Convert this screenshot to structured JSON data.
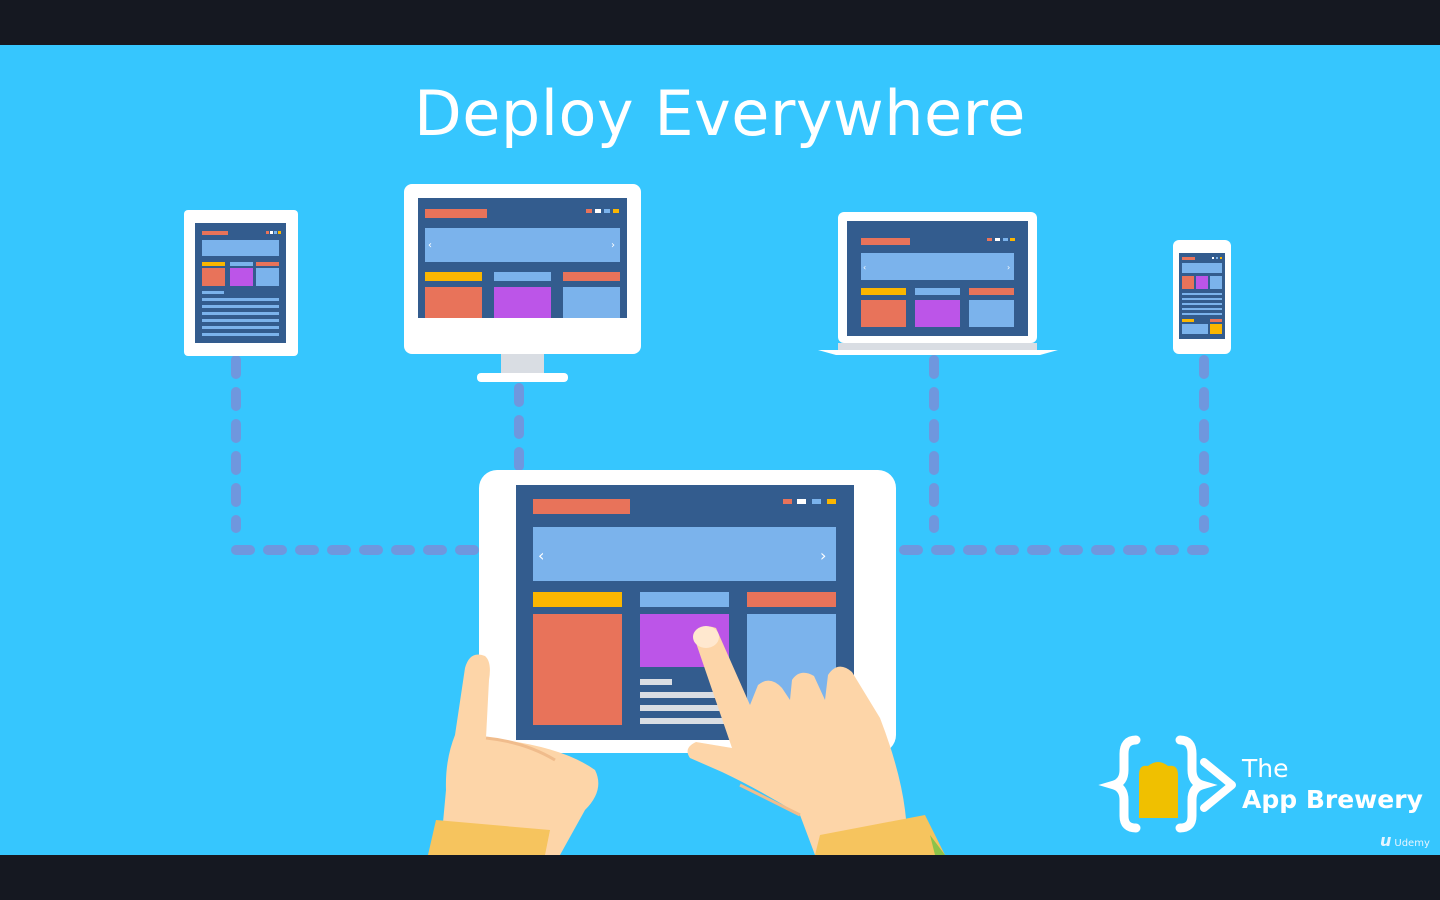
{
  "slide": {
    "title": "Deploy Everywhere",
    "background_color": "#36c6fe"
  },
  "devices": [
    "tablet",
    "desktop-monitor",
    "laptop",
    "smartphone",
    "tablet-held"
  ],
  "brand": {
    "line1": "The",
    "line2": "App Brewery",
    "icon": "code-braces-beer-icon"
  },
  "platform": {
    "name": "Udemy",
    "icon": "udemy-logo-icon"
  },
  "colors": {
    "screen": "#335c8e",
    "header_bar": "#e8735a",
    "accent_yellow": "#fbb600",
    "accent_purple": "#bc55e8",
    "accent_blue": "#7bb3ec",
    "connector": "#6f97de",
    "skin": "#fdd5a8"
  }
}
